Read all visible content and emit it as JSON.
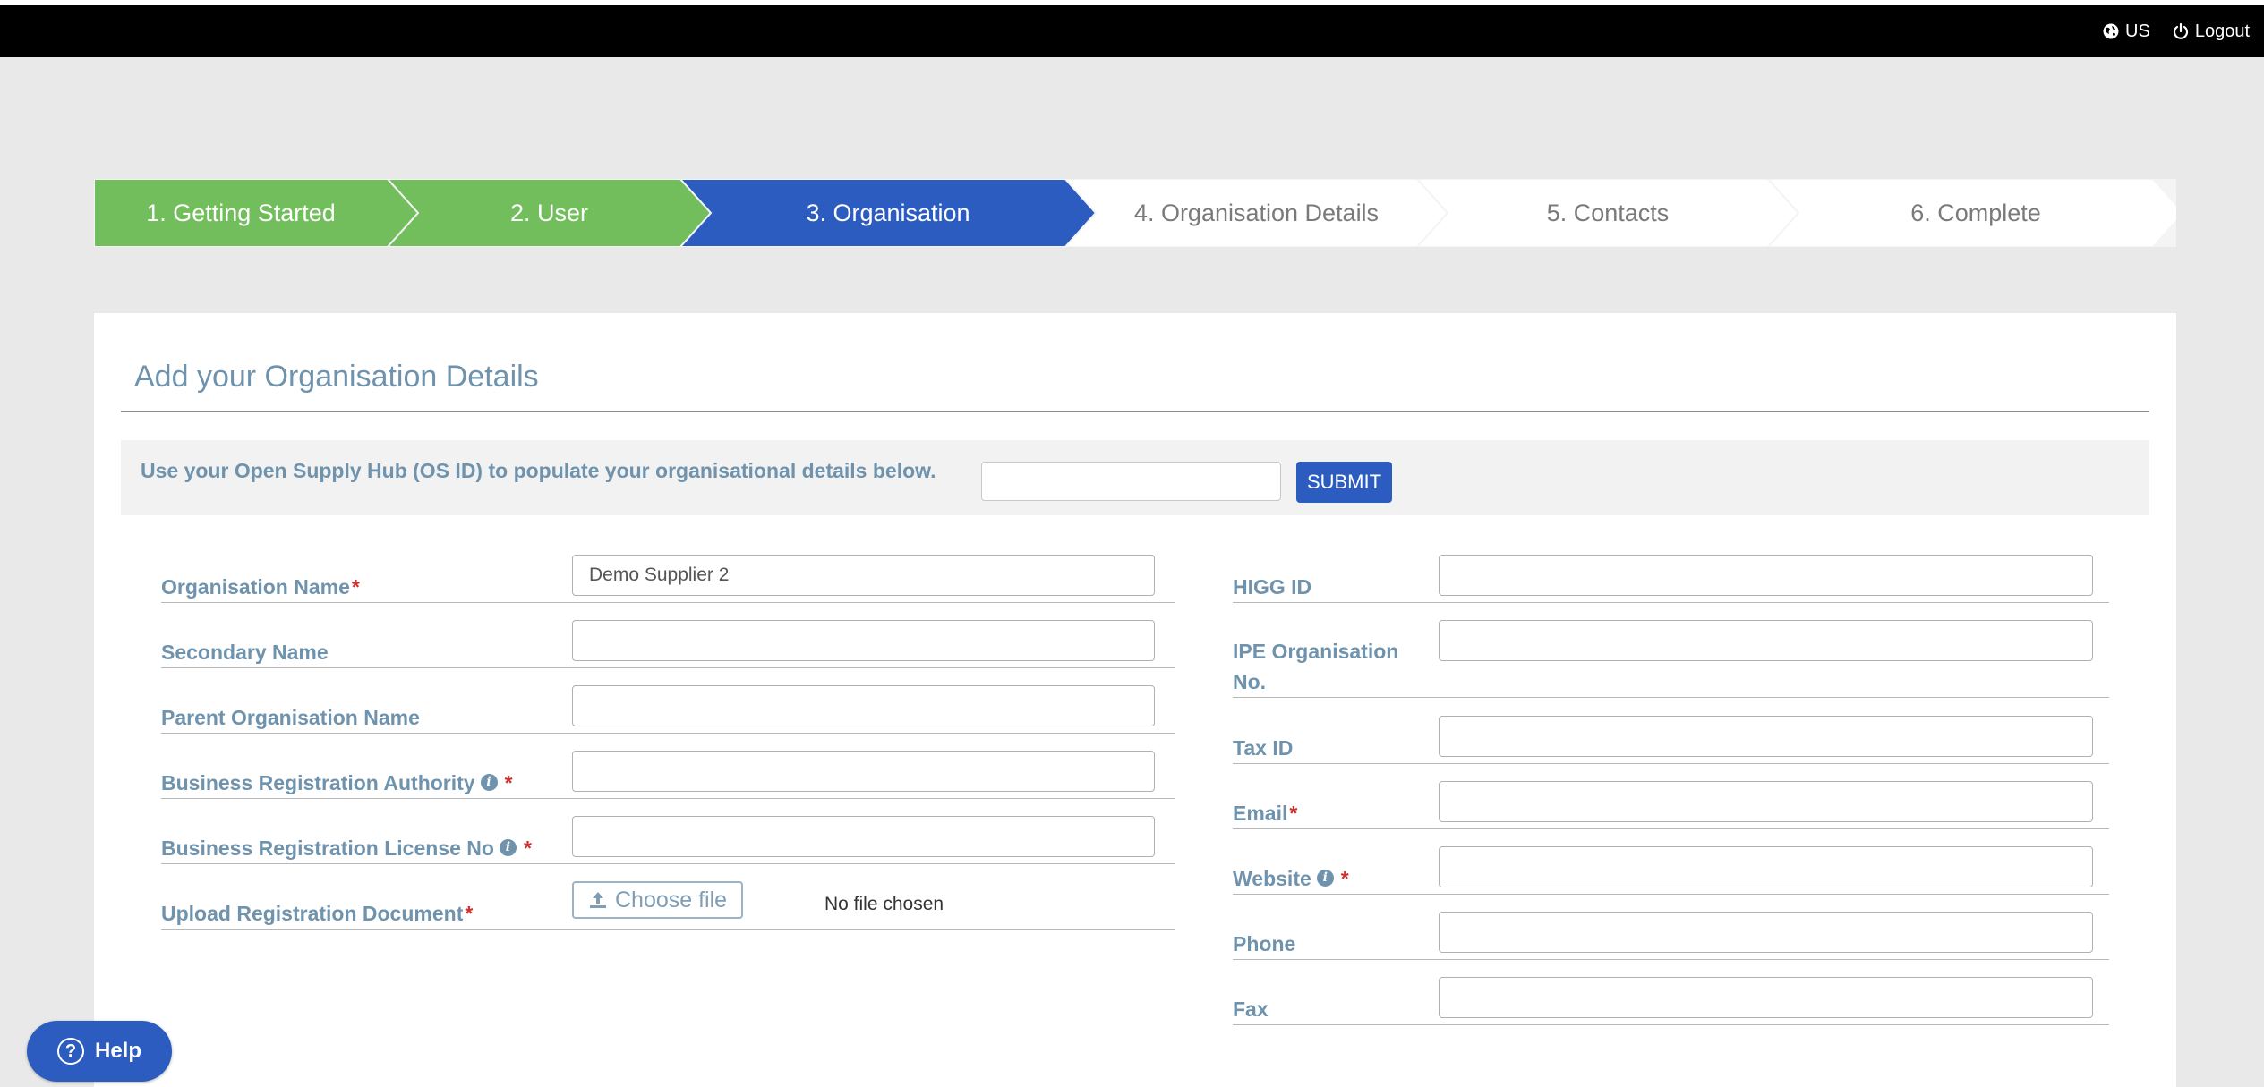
{
  "topbar": {
    "locale_label": "US",
    "logout_label": "Logout"
  },
  "wizard": {
    "steps": [
      {
        "label": "1. Getting Started",
        "state": "done"
      },
      {
        "label": "2. User",
        "state": "done"
      },
      {
        "label": "3. Organisation",
        "state": "active"
      },
      {
        "label": "4. Organisation Details",
        "state": "todo"
      },
      {
        "label": "5. Contacts",
        "state": "todo"
      },
      {
        "label": "6. Complete",
        "state": "todo"
      }
    ],
    "colors": {
      "done": "#72bd5c",
      "active": "#2c5cc0",
      "todo": "#ffffff"
    }
  },
  "card": {
    "title": "Add your Organisation Details",
    "os_id": {
      "label": "Use your Open Supply Hub (OS ID) to populate your organisational details below.",
      "value": "",
      "submit_label": "SUBMIT"
    }
  },
  "form": {
    "left": [
      {
        "label": "Organisation Name",
        "required": true,
        "info": false,
        "value": "Demo Supplier 2"
      },
      {
        "label": "Secondary Name",
        "required": false,
        "info": false,
        "value": ""
      },
      {
        "label": "Parent Organisation Name",
        "required": false,
        "info": false,
        "value": ""
      },
      {
        "label": "Business Registration Authority",
        "required": true,
        "info": true,
        "value": ""
      },
      {
        "label": "Business Registration License No",
        "required": true,
        "info": true,
        "value": ""
      }
    ],
    "upload": {
      "label": "Upload Registration Document",
      "button_label": "Choose file",
      "status": "No file chosen"
    },
    "right": [
      {
        "label": "HIGG ID",
        "required": false,
        "info": false,
        "value": ""
      },
      {
        "label": "IPE Organisation No.",
        "required": false,
        "info": false,
        "value": ""
      },
      {
        "label": "Tax ID",
        "required": false,
        "info": false,
        "value": ""
      },
      {
        "label": "Email",
        "required": true,
        "info": false,
        "value": ""
      },
      {
        "label": "Website",
        "required": true,
        "info": true,
        "value": ""
      },
      {
        "label": "Phone",
        "required": false,
        "info": false,
        "value": ""
      },
      {
        "label": "Fax",
        "required": false,
        "info": false,
        "value": ""
      }
    ]
  },
  "help": {
    "label": "Help"
  }
}
